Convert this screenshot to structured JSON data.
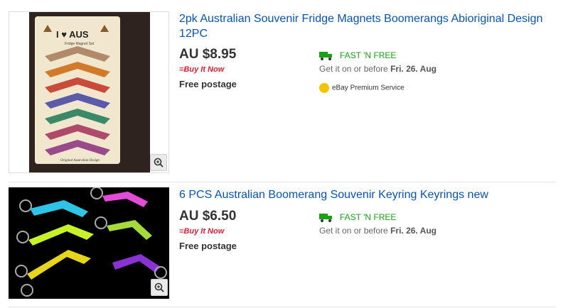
{
  "listings": [
    {
      "title": "2pk Australian Souvenir Fridge Magnets Boomerangs Abioriginal Design 12PC",
      "price": "AU $8.95",
      "format_prefix": "Buy It",
      "format_suffix": "Now",
      "postage": "Free postage",
      "shipping_label": "FAST 'N FREE",
      "delivery_prefix": "Get it on or before",
      "delivery_date": "Fri. 26. Aug",
      "premium_service": "eBay Premium Service",
      "card_text": "I ♥ AUS",
      "card_subtext": "Fridge Magnet Set",
      "card_footer": "Original Australian Design"
    },
    {
      "title": "6 PCS Australian Boomerang Souvenir Keyring Keyrings new",
      "price": "AU $6.50",
      "format_prefix": "Buy It",
      "format_suffix": "Now",
      "postage": "Free postage",
      "shipping_label": "FAST 'N FREE",
      "delivery_prefix": "Get it on or before",
      "delivery_date": "Fri. 26. Aug"
    }
  ],
  "colors": {
    "link": "#0654ba",
    "buy_it_now": "#dd1e31",
    "fast_free": "#16a413"
  }
}
